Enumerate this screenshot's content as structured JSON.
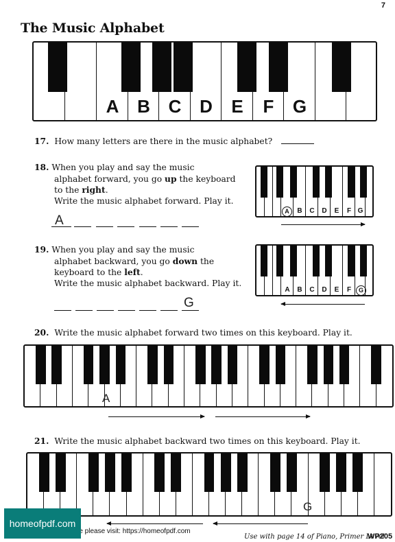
{
  "page_number": "7",
  "title": "The Music Alphabet",
  "alphabet_letters": [
    "A",
    "B",
    "C",
    "D",
    "E",
    "F",
    "G"
  ],
  "q17": {
    "num": "17.",
    "text": "How many letters are there in the music alphabet?"
  },
  "q18": {
    "num": "18.",
    "line1": "When you play and say the music",
    "line2_a": "alphabet forward, you go ",
    "line2_b": "up",
    "line2_c": " the keyboard",
    "line3_a": "to the ",
    "line3_b": "right",
    "line3_c": ".",
    "line4": "Write the music alphabet forward. Play it.",
    "answer_first": "A",
    "key_letters": [
      "A",
      "B",
      "C",
      "D",
      "E",
      "F",
      "G"
    ]
  },
  "q19": {
    "num": "19.",
    "line1": "When you play and say the music",
    "line2_a": "alphabet backward, you go ",
    "line2_b": "down",
    "line2_c": " the",
    "line3_a": "keyboard to the ",
    "line3_b": "left",
    "line3_c": ".",
    "line4": "Write the music alphabet backward. Play it.",
    "answer_last": "G",
    "key_letters": [
      "A",
      "B",
      "C",
      "D",
      "E",
      "F",
      "G"
    ]
  },
  "q20": {
    "num": "20.",
    "text": "Write the music alphabet forward two times on this keyboard. Play it.",
    "handwritten": "A"
  },
  "q21": {
    "num": "21.",
    "text": "Write the music alphabet backward two times on this keyboard. Play it.",
    "handwritten": "G"
  },
  "footer": {
    "use_with": "Use with page 14 of ",
    "book": "Piano, Primer Level.",
    "code": "WP205",
    "visit": "re please visit: https://homeofpdf.com"
  },
  "watermark": "homeofpdf.com"
}
